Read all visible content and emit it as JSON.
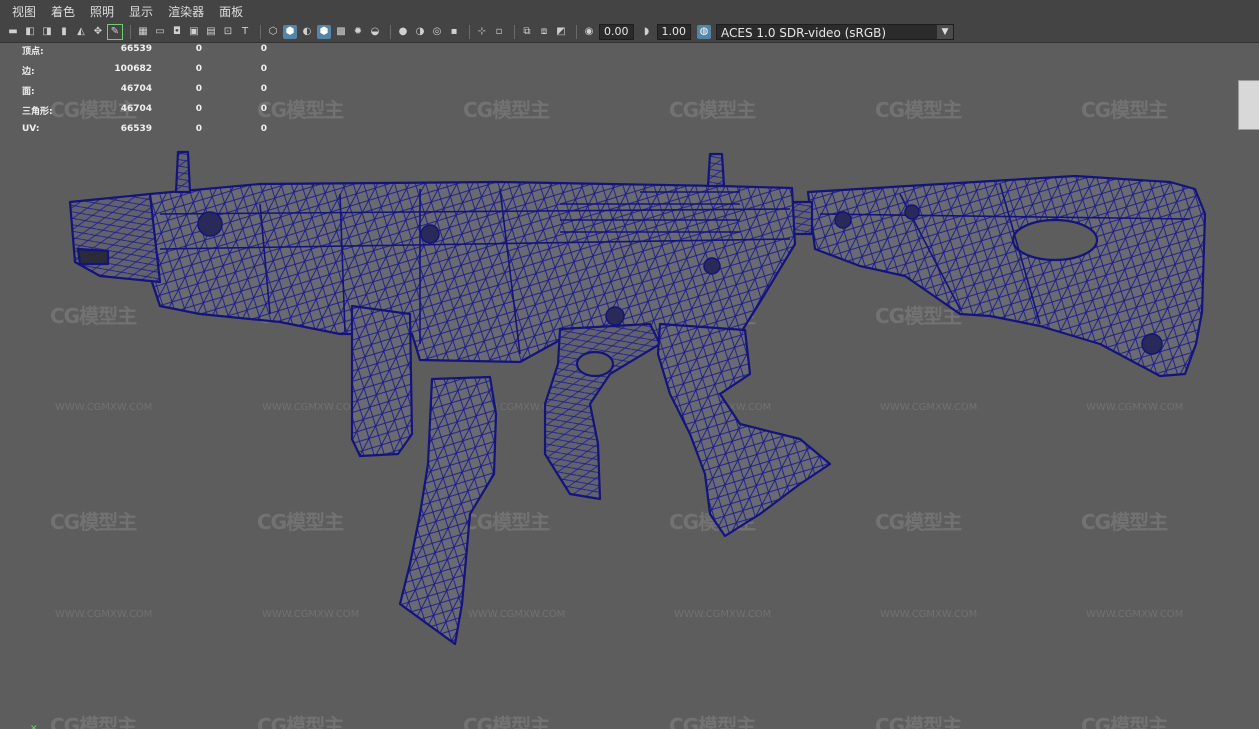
{
  "menubar": {
    "items": [
      "视图",
      "着色",
      "照明",
      "显示",
      "渲染器",
      "面板"
    ]
  },
  "toolbar": {
    "exposure_value": "0.00",
    "gamma_value": "1.00",
    "color_space": "ACES 1.0 SDR-video (sRGB)"
  },
  "hud": {
    "rows": [
      {
        "label": "顶点:",
        "v1": "66539",
        "v2": "0",
        "v3": "0"
      },
      {
        "label": "边:",
        "v1": "100682",
        "v2": "0",
        "v3": "0"
      },
      {
        "label": "面:",
        "v1": "46704",
        "v2": "0",
        "v3": "0"
      },
      {
        "label": "三角形:",
        "v1": "46704",
        "v2": "0",
        "v3": "0"
      },
      {
        "label": "UV:",
        "v1": "66539",
        "v2": "0",
        "v3": "0"
      }
    ]
  },
  "watermark": {
    "logo": "CG模型主",
    "url": "WWW.CGMXW.COM"
  },
  "colors": {
    "background": "#5d5d5d",
    "wireframe": "#1a1a8c",
    "mesh_fill": "#6a6a72",
    "menubar": "#444444",
    "active_tool": "#5285a6"
  },
  "icons": [
    "camera-icon",
    "camera-attr-icon",
    "bookmark-icon",
    "image-plane-icon",
    "grid-icon",
    "film-gate-icon",
    "resolution-gate-icon",
    "wireframe-icon",
    "smooth-shade-icon",
    "textured-icon",
    "lights-icon",
    "shadows-icon",
    "xray-icon",
    "isolate-icon",
    "exposure-icon",
    "gamma-icon",
    "color-mgmt-icon"
  ]
}
